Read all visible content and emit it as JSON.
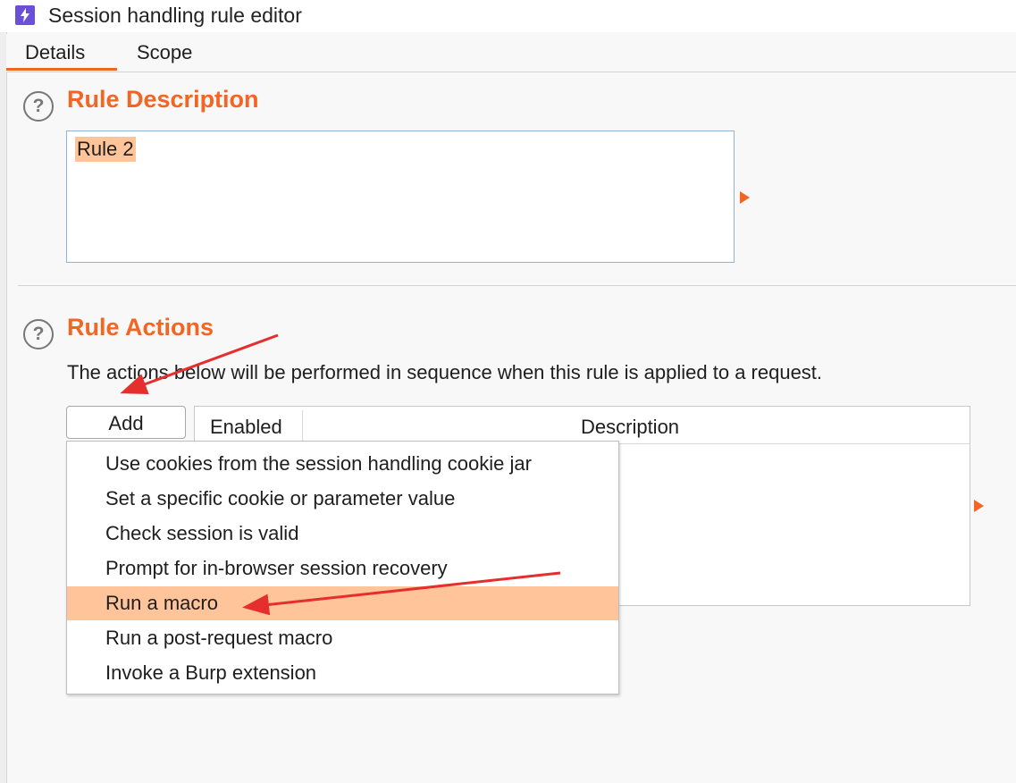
{
  "window": {
    "title": "Session handling rule editor"
  },
  "tabs": [
    {
      "label": "Details",
      "active": true
    },
    {
      "label": "Scope",
      "active": false
    }
  ],
  "rule_description": {
    "heading": "Rule Description",
    "value": "Rule 2"
  },
  "rule_actions": {
    "heading": "Rule Actions",
    "description": "The actions below will be performed in sequence when this rule is applied to a request.",
    "add_label": "Add",
    "table": {
      "columns": [
        "Enabled",
        "Description"
      ],
      "rows": []
    },
    "menu": {
      "items": [
        "Use cookies from the session handling cookie jar",
        "Set a specific cookie or parameter value",
        "Check session is valid",
        "Prompt for in-browser session recovery",
        "Run a macro",
        "Run a post-request macro",
        "Invoke a Burp extension"
      ],
      "highlighted": "Run a macro"
    }
  },
  "icons": {
    "app": "burp-lightning-icon",
    "help": "question-circle-icon",
    "expand": "triangle-right-icon"
  },
  "colors": {
    "accent": "#f26522",
    "selection": "#ffc49a",
    "annotation_arrow": "#e52e2e",
    "app_icon": "#6b4fd8"
  }
}
